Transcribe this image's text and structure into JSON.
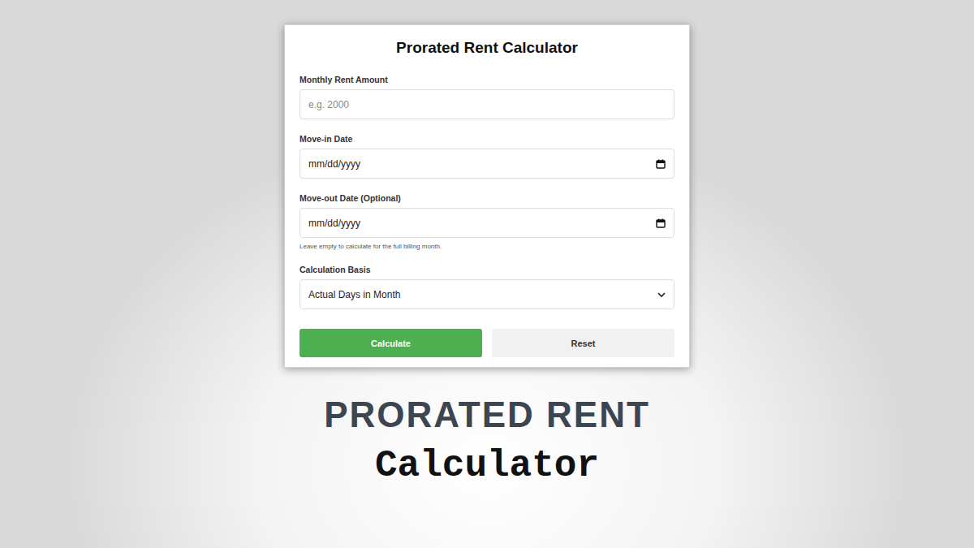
{
  "card": {
    "title": "Prorated Rent Calculator",
    "fields": [
      {
        "kind": "text",
        "label": "Monthly Rent Amount",
        "placeholder": "e.g. 2000",
        "hint": ""
      },
      {
        "kind": "date",
        "label": "Move-in Date",
        "placeholder": "mm/dd/yyyy",
        "hint": ""
      },
      {
        "kind": "date",
        "label": "Move-out Date (Optional)",
        "placeholder": "mm/dd/yyyy",
        "hint": "Leave empty to calculate for the full billing month."
      },
      {
        "kind": "select",
        "label": "Calculation Basis",
        "placeholder": "Actual Days in Month",
        "hint": ""
      }
    ],
    "buttons": [
      {
        "label": "Calculate",
        "kind": "primary"
      },
      {
        "label": "Reset",
        "kind": "secondary"
      }
    ]
  },
  "headline": {
    "line1": "PRORATED RENT",
    "line2": "Calculator"
  }
}
